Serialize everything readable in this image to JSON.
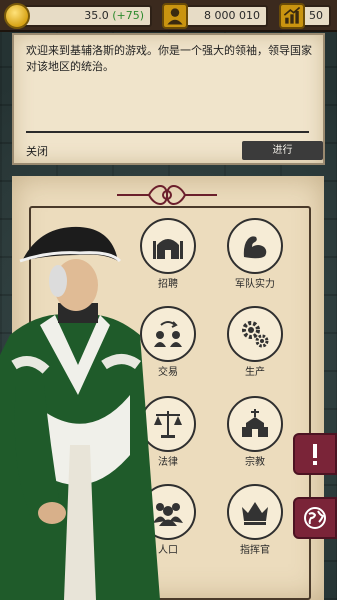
{
  "stats": {
    "gold": "35.0",
    "gold_delta": "(+75)",
    "population": "8 000 010",
    "level": "50"
  },
  "dialog": {
    "message": "欢迎来到基辅洛斯的游戏。你是一个强大的领袖，领导国家对该地区的统治。",
    "close_label": "关闭",
    "proceed_label": "进行"
  },
  "grid": {
    "recruit": "招聘",
    "military": "军队实力",
    "trade": "交易",
    "production": "生产",
    "law": "法律",
    "religion": "宗教",
    "population": "人口",
    "commander": "指挥官"
  },
  "icons": {
    "gold": "coin-icon",
    "population": "person-icon",
    "level": "growth-chart-icon",
    "alert": "exclamation-icon",
    "world": "globe-icon"
  },
  "colors": {
    "parchment": "#ecdcbd",
    "top_bar": "#3b2a1e",
    "tab": "#7a2438",
    "delta_green": "#2e8a2e"
  }
}
